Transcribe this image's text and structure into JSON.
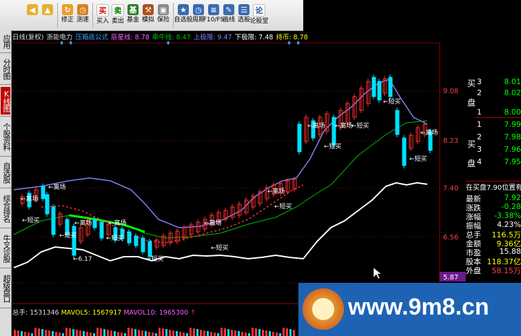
{
  "toolbar": {
    "buttons": [
      {
        "icon": "back-icon",
        "label": "",
        "color": "#e8b030",
        "glyph": "◀"
      },
      {
        "icon": "up-arrow-icon",
        "label": "",
        "color": "#e8b030",
        "glyph": "▲"
      },
      {
        "icon": "refresh-icon",
        "label": "修正",
        "color": "#e8a020",
        "glyph": "↻"
      },
      {
        "icon": "clock-icon",
        "label": "测速",
        "color": "#d88020",
        "glyph": "◷"
      },
      {
        "icon": "buy-icon",
        "label": "买入",
        "color": "#ffffff",
        "glyph": "买",
        "fg": "#d00000"
      },
      {
        "icon": "sell-icon",
        "label": "卖出",
        "color": "#ffffff",
        "glyph": "卖",
        "fg": "#008000"
      },
      {
        "icon": "fund-icon",
        "label": "基金",
        "color": "#2a7a2a",
        "glyph": "基"
      },
      {
        "icon": "hammer-icon",
        "label": "模拟",
        "color": "#b0501a",
        "glyph": "⚒"
      },
      {
        "icon": "lock-icon",
        "label": "保险",
        "color": "#8a8a8a",
        "glyph": "▣"
      },
      {
        "icon": "favorites-icon",
        "label": "自选股",
        "color": "#3a6ab0",
        "glyph": "★"
      },
      {
        "icon": "period-icon",
        "label": "周期",
        "color": "#3a6ab0",
        "glyph": "◷"
      },
      {
        "icon": "f10-icon",
        "label": "F10/F9",
        "color": "#3a6ab0",
        "glyph": "≡"
      },
      {
        "icon": "pen-icon",
        "label": "画线",
        "color": "#3a6ab0",
        "glyph": "✎"
      },
      {
        "icon": "screener-icon",
        "label": "选股",
        "color": "#3a6ab0",
        "glyph": "☰"
      },
      {
        "icon": "forum-icon",
        "label": "论股堂",
        "color": "#ffffff",
        "glyph": "论",
        "fg": "#1e4fa0"
      }
    ]
  },
  "sidebar": {
    "tabs": [
      {
        "label": "应用",
        "active": false
      },
      {
        "label": "分时图",
        "active": false
      },
      {
        "label": "K线图",
        "active": true
      },
      {
        "label": "个股资料",
        "active": false
      },
      {
        "label": "自选股",
        "active": false
      },
      {
        "label": "综合排名",
        "active": false
      },
      {
        "label": "牛叉诊股",
        "active": false
      },
      {
        "label": "超级盘口",
        "active": false
      }
    ]
  },
  "legend": {
    "period": "日线(复权)",
    "stock": "浙能电力",
    "formula": "压箱底公式",
    "items": [
      {
        "label": "辰星线: 8.78",
        "color": "#ff60ff"
      },
      {
        "label": "牵牛线: 8.47",
        "color": "#00c000"
      },
      {
        "label": "上极限: 9.47",
        "color": "#8080ff"
      },
      {
        "label": "下极限: 7.48",
        "color": "#ffffff"
      },
      {
        "label": "持币: 8.78",
        "color": "#ffff00"
      }
    ]
  },
  "price_axis": {
    "labels": [
      "9.08",
      "8.23",
      "7.40",
      "6.56",
      "5.87"
    ]
  },
  "annotations": {
    "leave": "←离场",
    "short_buy": "←短买",
    "low": "←6.17"
  },
  "volume_legend": {
    "total": "总手: 1531346",
    "mavol5": "MAVOL5: 1567917",
    "mavol10": "MAVOL10: 1965300"
  },
  "quote_panel": {
    "buy_label_1": "买",
    "buy_label_2": "盘",
    "sell_label_1": "买",
    "sell_label_2": "盘",
    "rows": [
      {
        "n": "3",
        "v": "8.01"
      },
      {
        "n": "2",
        "v": "8.02"
      },
      {
        "n": "1",
        "v": "8.00"
      },
      {
        "n": "1",
        "v": "7.99"
      },
      {
        "n": "2",
        "v": "7.98"
      },
      {
        "n": "3",
        "v": "7.96"
      },
      {
        "n": "4",
        "v": "7.95"
      }
    ],
    "position_note": "在买盘7.90位置有",
    "stats": [
      {
        "label": "最新",
        "value": "7.92",
        "color": "#00ff00"
      },
      {
        "label": "涨跌",
        "value": "-0.28",
        "color": "#00ff00"
      },
      {
        "label": "涨幅",
        "value": "-3.38%",
        "color": "#00ff00"
      },
      {
        "label": "振幅",
        "value": "4.23%",
        "color": "#ffffff"
      },
      {
        "label": "总手",
        "value": "116.5万",
        "color": "#ffff00"
      },
      {
        "label": "金额",
        "value": "9.36亿",
        "color": "#ffff00"
      },
      {
        "label": "市盈",
        "value": "15.88",
        "color": "#ffffff"
      },
      {
        "label": "股本",
        "value": "118.37亿",
        "color": "#ffff00"
      },
      {
        "label": "外盘",
        "value": "58.15万",
        "color": "#ff4040"
      }
    ]
  },
  "watermark": {
    "text": "www.9m8.cn"
  },
  "colors": {
    "up": "#ff3030",
    "down": "#00e0ff",
    "grid": "#7a0000"
  }
}
